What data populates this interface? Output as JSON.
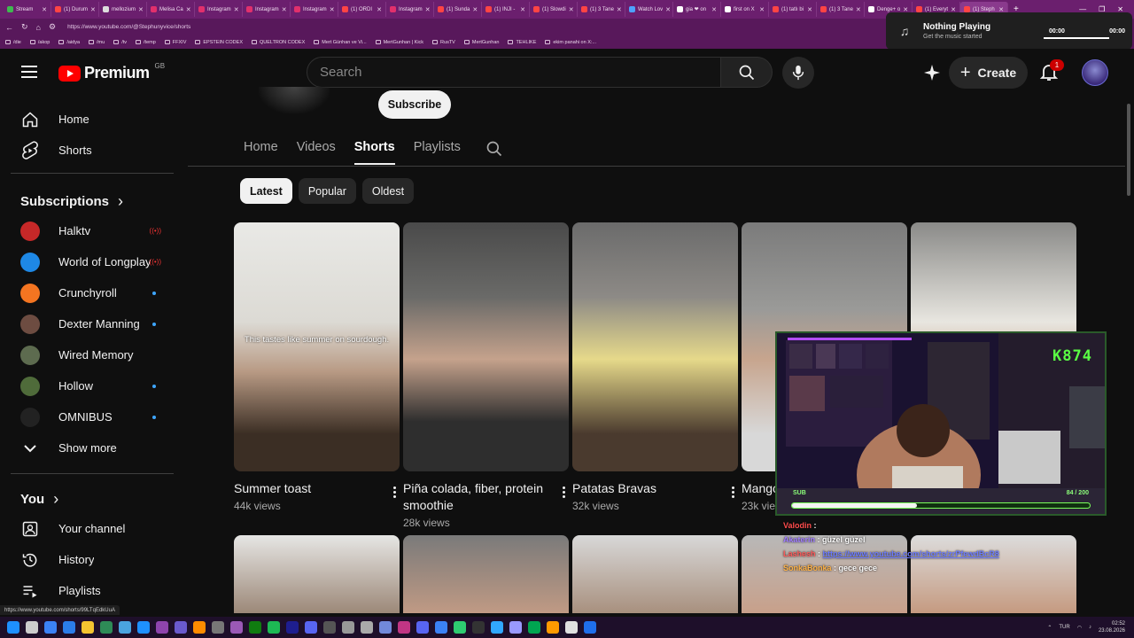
{
  "browser": {
    "tabs": [
      {
        "label": "Stream",
        "color": "#3fb950"
      },
      {
        "label": "(1) Durum",
        "color": "#ff4444"
      },
      {
        "label": "mellozium",
        "color": "#dddddd"
      },
      {
        "label": "Melisa Ca",
        "color": "#e1306c"
      },
      {
        "label": "Instagram",
        "color": "#e1306c"
      },
      {
        "label": "Instagram",
        "color": "#e1306c"
      },
      {
        "label": "Instagram",
        "color": "#e1306c"
      },
      {
        "label": "(1) ORDI",
        "color": "#ff4444"
      },
      {
        "label": "Instagram",
        "color": "#e1306c"
      },
      {
        "label": "(1) Sunda",
        "color": "#ff4444"
      },
      {
        "label": "(1) INJI -",
        "color": "#ff4444"
      },
      {
        "label": "(1) Slowdi",
        "color": "#ff4444"
      },
      {
        "label": "(1) 3 Tane",
        "color": "#ff4444"
      },
      {
        "label": "Watch Lov",
        "color": "#4ea1ff"
      },
      {
        "label": "gia ❤ on",
        "color": "#ffffff"
      },
      {
        "label": "first on X",
        "color": "#ffffff"
      },
      {
        "label": "(1) tatlı bi",
        "color": "#ff4444"
      },
      {
        "label": "(1) 3 Tane",
        "color": "#ff4444"
      },
      {
        "label": "Denge+ o",
        "color": "#ffffff"
      },
      {
        "label": "(1) Everyt",
        "color": "#ff4444"
      },
      {
        "label": "(1) Steph",
        "color": "#ff4444"
      }
    ],
    "url": "https://www.youtube.com/@Stephunyvice/shorts",
    "bookmarks": [
      "/die",
      "/akop",
      "/aidya",
      "/mu",
      "/tv",
      "/temp",
      "FFXIV",
      "EPSTEIN CODEX",
      "QUELTRON CODEX",
      "Mert Günhan ve Vi...",
      "MertGunhan | Kick",
      "RusTV",
      "MertGunhan",
      "TEHLIKE",
      "ekim panahi on X:..."
    ],
    "status_url": "https://www.youtube.com/shorts/99LTqEdkUuA"
  },
  "media": {
    "title": "Nothing Playing",
    "subtitle": "Get the music started",
    "time_start": "00:00",
    "time_end": "00:00"
  },
  "masthead": {
    "logo_text": "Premium",
    "region": "GB",
    "search_placeholder": "Search",
    "create_label": "Create",
    "notifications": "1"
  },
  "sidebar": {
    "main": [
      {
        "label": "Home",
        "icon": "home-icon"
      },
      {
        "label": "Shorts",
        "icon": "shorts-icon"
      }
    ],
    "subscriptions_title": "Subscriptions",
    "subscriptions": [
      {
        "label": "Halktv",
        "status": "live",
        "color": "#c62828"
      },
      {
        "label": "World of Longplays",
        "status": "live",
        "color": "#1e88e5"
      },
      {
        "label": "Crunchyroll",
        "status": "new",
        "color": "#f47521"
      },
      {
        "label": "Dexter Manning",
        "status": "new",
        "color": "#6d4c41"
      },
      {
        "label": "Wired Memory",
        "status": "none",
        "color": "#5d6b4f"
      },
      {
        "label": "Hollow",
        "status": "new",
        "color": "#4f6b3a"
      },
      {
        "label": "OMNIBUS",
        "status": "new",
        "color": "#222222"
      }
    ],
    "show_more": "Show more",
    "you_title": "You",
    "you_items": [
      {
        "label": "Your channel",
        "icon": "your-channel-icon"
      },
      {
        "label": "History",
        "icon": "history-icon"
      },
      {
        "label": "Playlists",
        "icon": "playlists-icon"
      }
    ]
  },
  "channel": {
    "subscribe_label": "Subscribe",
    "tabs": [
      "Home",
      "Videos",
      "Shorts",
      "Playlists"
    ],
    "active_tab": "Shorts",
    "chips": [
      "Latest",
      "Popular",
      "Oldest"
    ],
    "active_chip": "Latest"
  },
  "shorts": [
    {
      "title": "Summer toast",
      "views": "44k views",
      "caption": "This tastes like summer on sourdough."
    },
    {
      "title": "Piña colada, fiber, protein smoothie",
      "views": "28k views",
      "caption": ""
    },
    {
      "title": "Patatas Bravas",
      "views": "32k views",
      "caption": ""
    },
    {
      "title": "Mango",
      "views": "23k views",
      "caption": ""
    },
    {
      "title": "",
      "views": "",
      "caption": ""
    }
  ],
  "stream": {
    "counter": "K874",
    "sub_label": "SUB",
    "sub_count": "84 / 200",
    "sub_progress": 0.42
  },
  "chat": [
    {
      "user": "Valodin",
      "text": "",
      "color": "#ff4d4d"
    },
    {
      "user": "Akaterin",
      "text": "güzel güzel",
      "color": "#a07cff"
    },
    {
      "user": "Lashesh",
      "text": "https://www.youtube.com/shorts/zrPfewdBcR8",
      "color": "#ff5a5a"
    },
    {
      "user": "SonkaBonka",
      "text": "gece gece",
      "color": "#ffb347"
    }
  ],
  "taskbar": {
    "lang": "TUR",
    "time": "02:52",
    "date": "23.08.2026"
  }
}
